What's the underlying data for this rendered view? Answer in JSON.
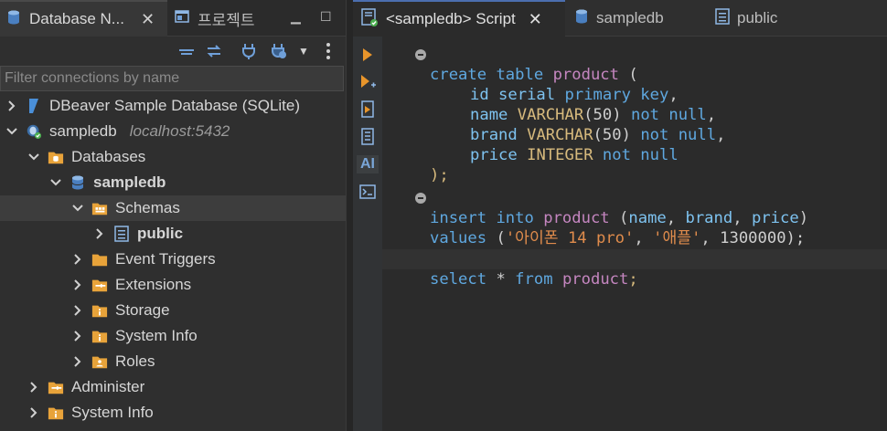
{
  "left_panel": {
    "tabs": {
      "navigator": "Database N...",
      "project": "프로젝트"
    },
    "filter_placeholder": "Filter connections by name",
    "tree": [
      {
        "label": "DBeaver Sample Database (SQLite)"
      },
      {
        "label": "sampledb",
        "host": "localhost:5432"
      },
      {
        "label": "Databases"
      },
      {
        "label": "sampledb"
      },
      {
        "label": "Schemas"
      },
      {
        "label": "public"
      },
      {
        "label": "Event Triggers"
      },
      {
        "label": "Extensions"
      },
      {
        "label": "Storage"
      },
      {
        "label": "System Info"
      },
      {
        "label": "Roles"
      },
      {
        "label": "Administer"
      },
      {
        "label": "System Info"
      }
    ]
  },
  "editor": {
    "tabs": {
      "script": "<sampledb> Script",
      "sampledb": "sampledb",
      "public": "public"
    },
    "ai_label": "AI",
    "code": {
      "l1": [
        "create",
        "table",
        "product",
        "("
      ],
      "l2": [
        "id serial",
        "primary",
        "key",
        ","
      ],
      "l3": [
        "name",
        "VARCHAR",
        "(50)",
        "not null",
        ","
      ],
      "l4": [
        "brand",
        "VARCHAR",
        "(50)",
        "not null",
        ","
      ],
      "l5": [
        "price",
        "INTEGER",
        "not null"
      ],
      "l6": [
        ");"
      ],
      "l8": [
        "insert",
        "into",
        "product",
        "(",
        "name",
        ", ",
        "brand",
        ", ",
        "price",
        ")"
      ],
      "l9": [
        "values",
        "(",
        "'아이폰 14 pro'",
        ", ",
        "'애플'",
        ", 1300000);"
      ],
      "l11": [
        "select",
        "*",
        "from",
        "product",
        ";"
      ]
    }
  },
  "colors": {
    "keyword": "#5fa8e0",
    "table": "#c586c0",
    "type": "#d7ba7d",
    "string": "#e08c4c",
    "active_tab": "#4b6eaf"
  }
}
